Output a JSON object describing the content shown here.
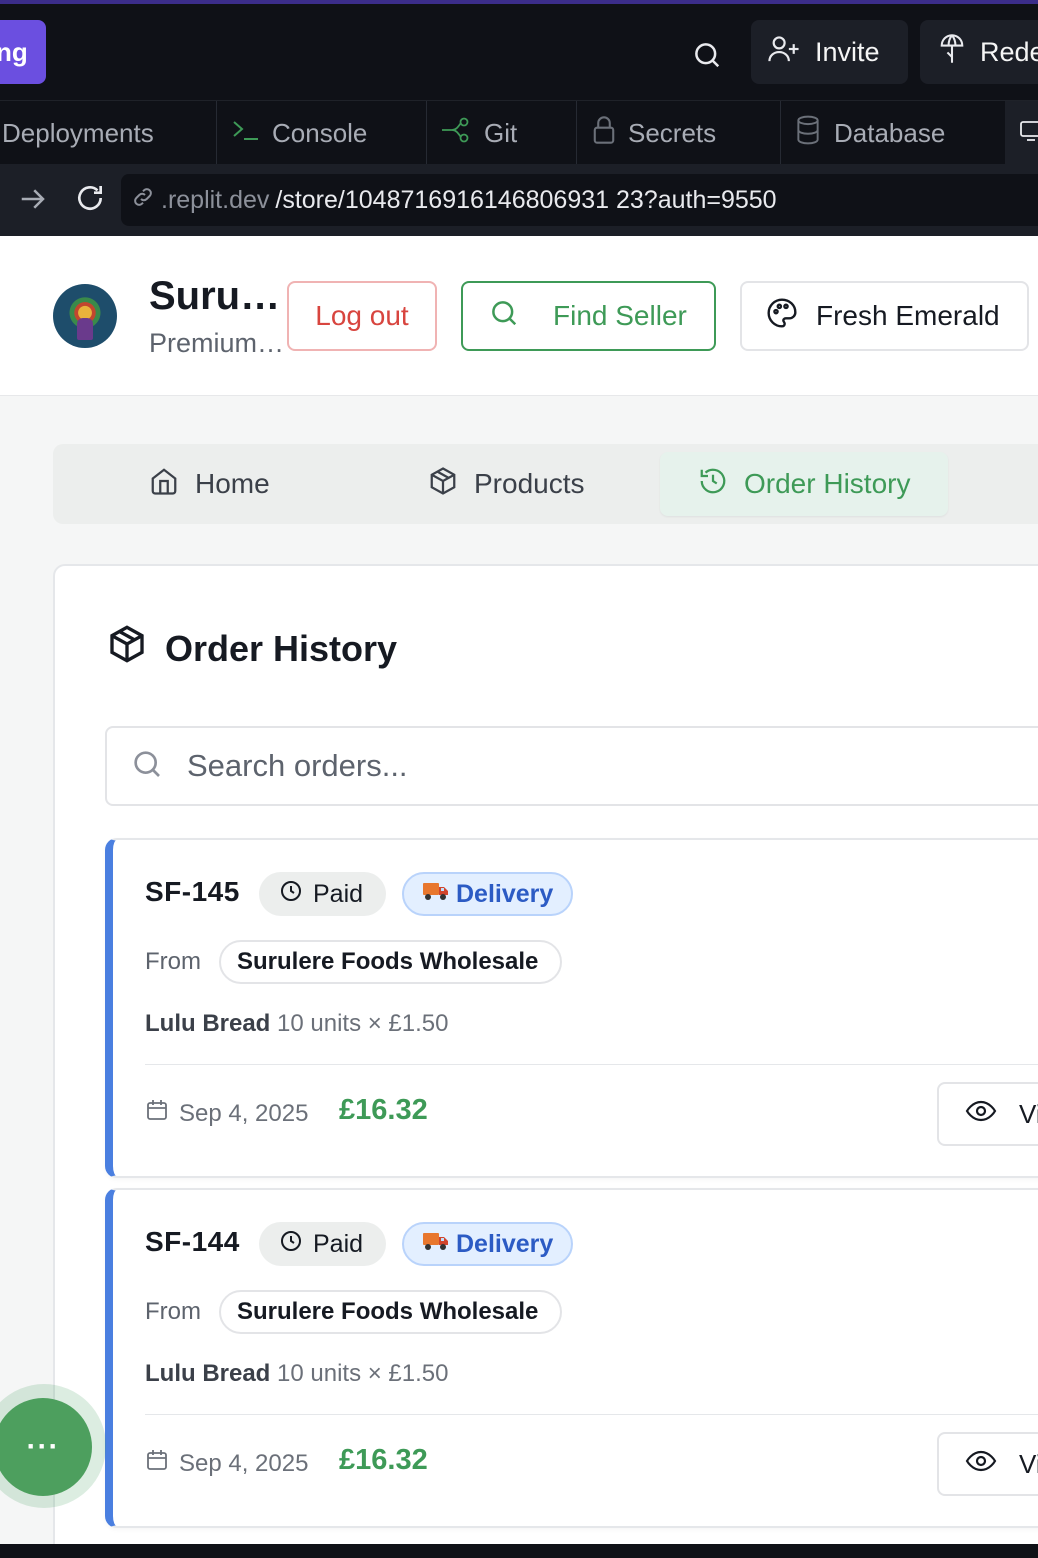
{
  "topbar": {
    "run_label": "ng",
    "invite_label": "Invite",
    "redeploy_label": "Redeploy"
  },
  "tabs": [
    {
      "label": "Deployments",
      "icon": "deploy-icon"
    },
    {
      "label": "Console",
      "icon": "terminal-icon"
    },
    {
      "label": "Git",
      "icon": "git-icon"
    },
    {
      "label": "Secrets",
      "icon": "lock-icon"
    },
    {
      "label": "Database",
      "icon": "database-icon"
    }
  ],
  "urlbar": {
    "host": ".replit.dev",
    "path": "/store/1048716916146806931 23?auth=9550"
  },
  "header": {
    "store_name": "Surulere Foods Wholesale",
    "store_subtitle": "Premium Foods",
    "logout_label": "Log out",
    "find_seller_label": "Find Seller",
    "theme_label": "Fresh Emerald"
  },
  "nav": {
    "home_label": "Home",
    "products_label": "Products",
    "order_history_label": "Order History"
  },
  "orders_card": {
    "title": "Order History",
    "search_placeholder": "Search orders...",
    "from_label": "From",
    "view_label": "View",
    "orders": [
      {
        "id": "SF-145",
        "status": "Paid",
        "method": "Delivery",
        "seller": "Surulere Foods Wholesale",
        "item_name": "Lulu Bread",
        "item_detail": "10 units × £1.50",
        "date": "Sep 4, 2025",
        "total": "£16.32"
      },
      {
        "id": "SF-144",
        "status": "Paid",
        "method": "Delivery",
        "seller": "Surulere Foods Wholesale",
        "item_name": "Lulu Bread",
        "item_detail": "10 units × £1.50",
        "date": "Sep 4, 2025",
        "total": "£16.32"
      }
    ]
  },
  "fab": {
    "label": "···"
  },
  "colors": {
    "accent_green": "#3e9a57",
    "delivery_blue": "#2c5bc4",
    "logout_red": "#d8453f",
    "replit_purple": "#6b4fe0"
  }
}
